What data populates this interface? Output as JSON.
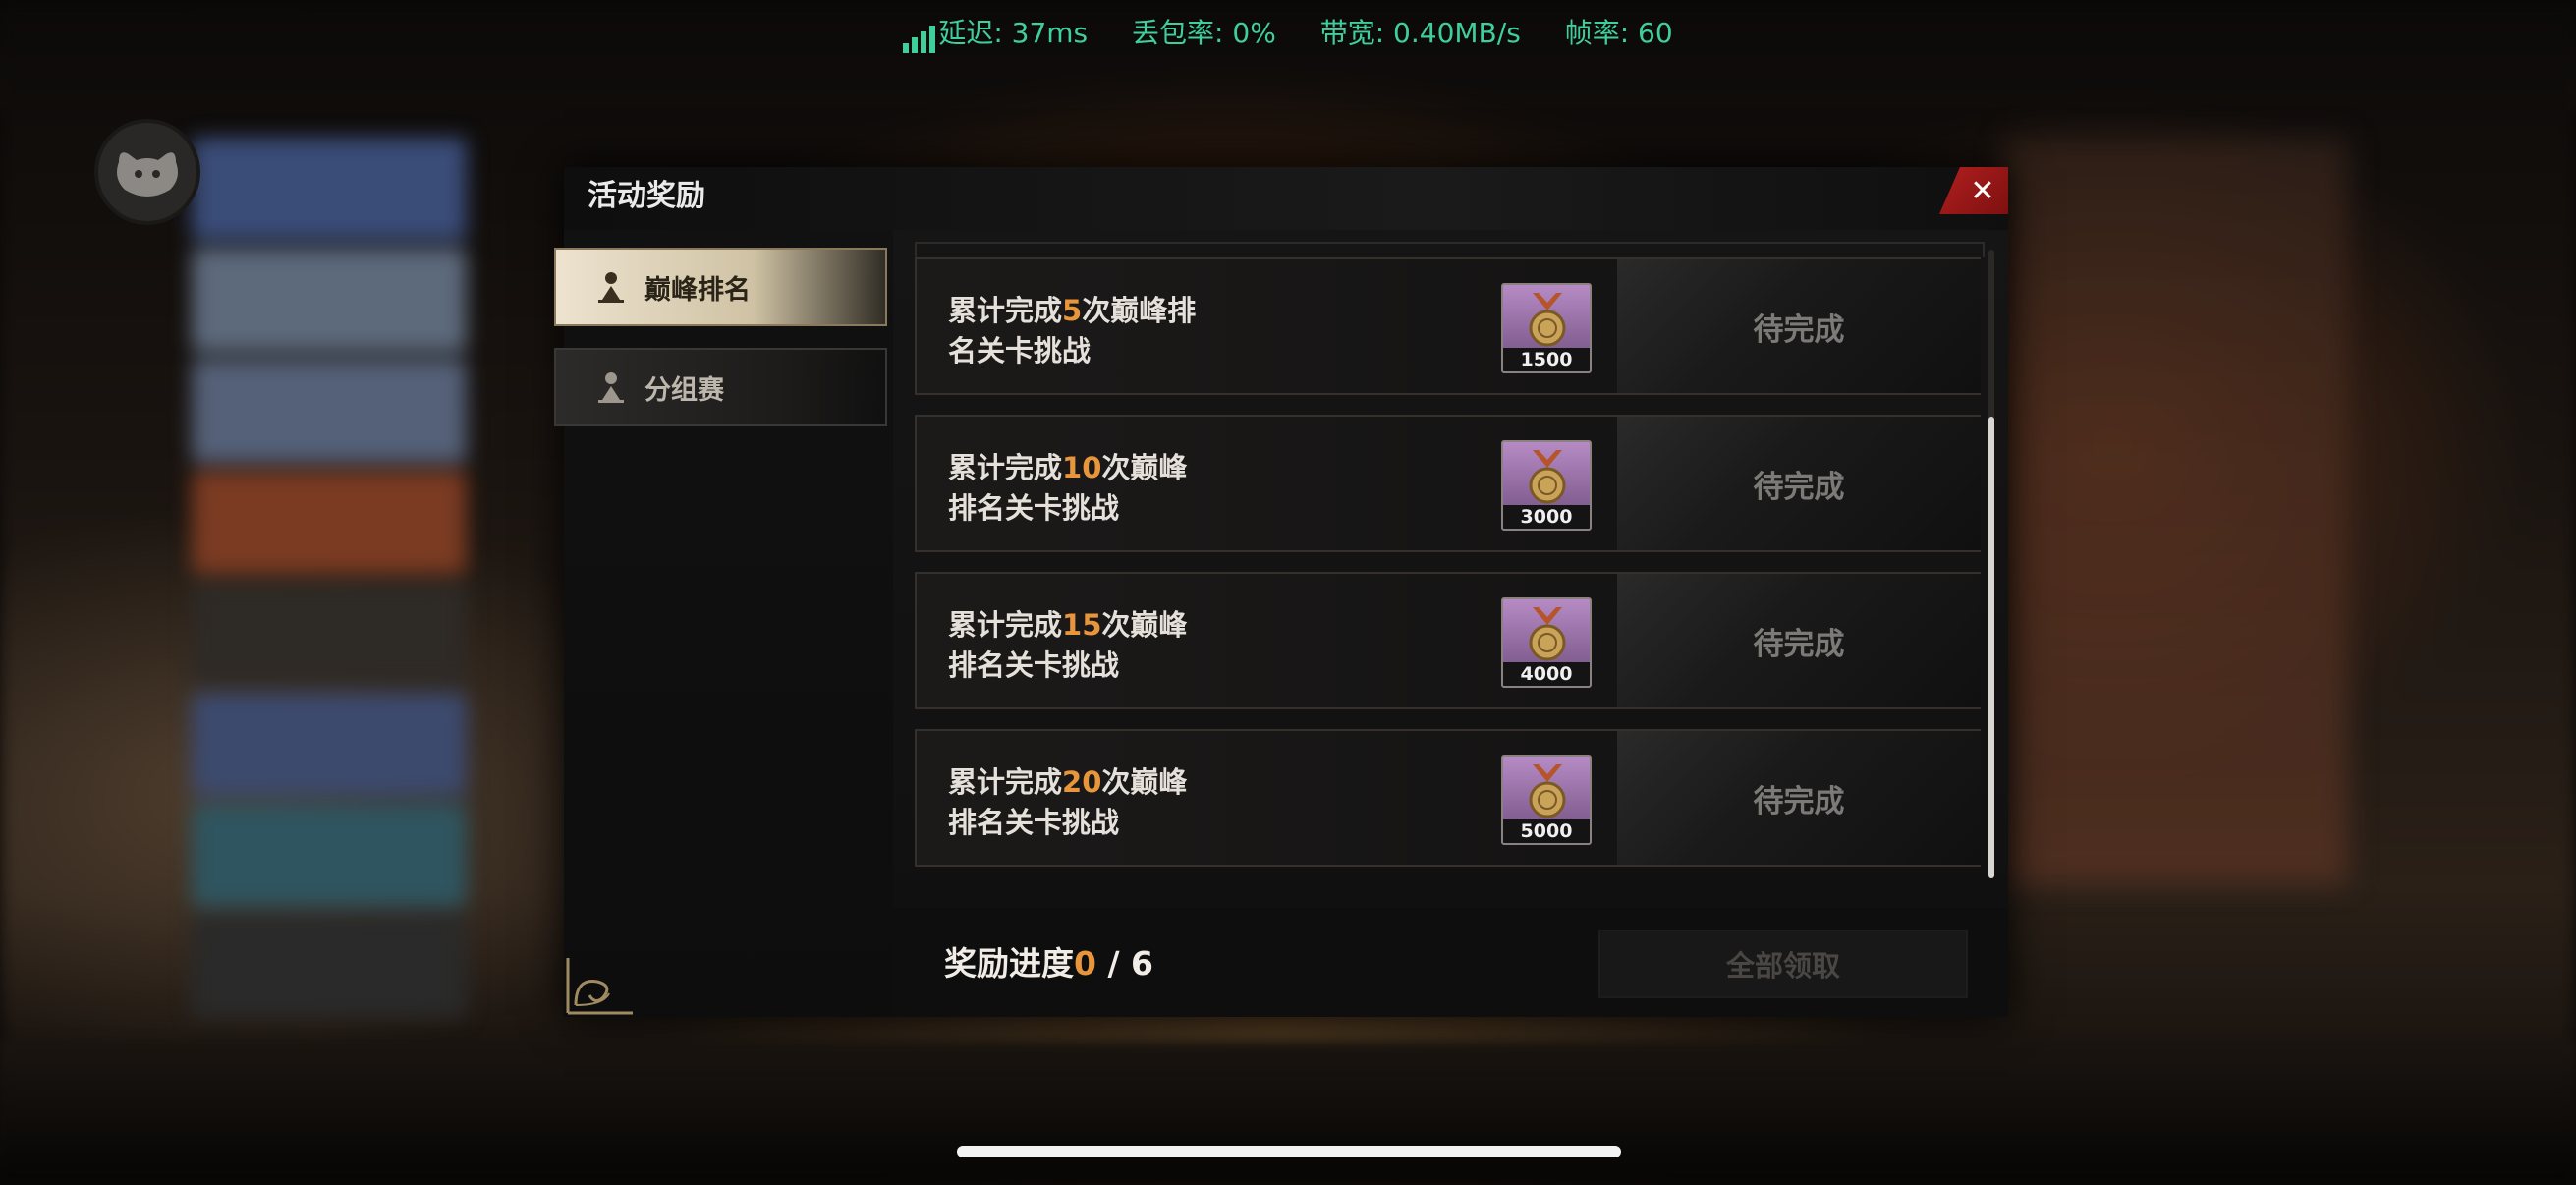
{
  "network_status": {
    "latency": "延迟: 37ms",
    "packet_loss": "丢包率: 0%",
    "bandwidth": "带宽: 0.40MB/s",
    "fps": "帧率: 60",
    "color": "#3fcf9a"
  },
  "modal": {
    "title": "活动奖励",
    "close_icon": "close-icon"
  },
  "sidebar": {
    "tabs": [
      {
        "label": "巅峰排名",
        "icon": "upload-person-icon",
        "active": true
      },
      {
        "label": "分组赛",
        "icon": "upload-person-icon",
        "active": false
      }
    ]
  },
  "rewards": [
    {
      "desc_prefix": "累计完成",
      "count": "5",
      "desc_suffix_line1": "次巅峰排",
      "desc_line2": "名关卡挑战",
      "item_qty": "1500",
      "status": "待完成"
    },
    {
      "desc_prefix": "累计完成",
      "count": "10",
      "desc_suffix_line1": "次巅峰",
      "desc_line2": "排名关卡挑战",
      "item_qty": "3000",
      "status": "待完成"
    },
    {
      "desc_prefix": "累计完成",
      "count": "15",
      "desc_suffix_line1": "次巅峰",
      "desc_line2": "排名关卡挑战",
      "item_qty": "4000",
      "status": "待完成"
    },
    {
      "desc_prefix": "累计完成",
      "count": "20",
      "desc_suffix_line1": "次巅峰",
      "desc_line2": "排名关卡挑战",
      "item_qty": "5000",
      "status": "待完成"
    }
  ],
  "footer": {
    "progress_label": "奖励进度",
    "progress_current": "0",
    "progress_total": " / 6",
    "claim_all": "全部领取"
  },
  "colors": {
    "accent_orange": "#e8963b",
    "close_red": "#b21f1f"
  }
}
